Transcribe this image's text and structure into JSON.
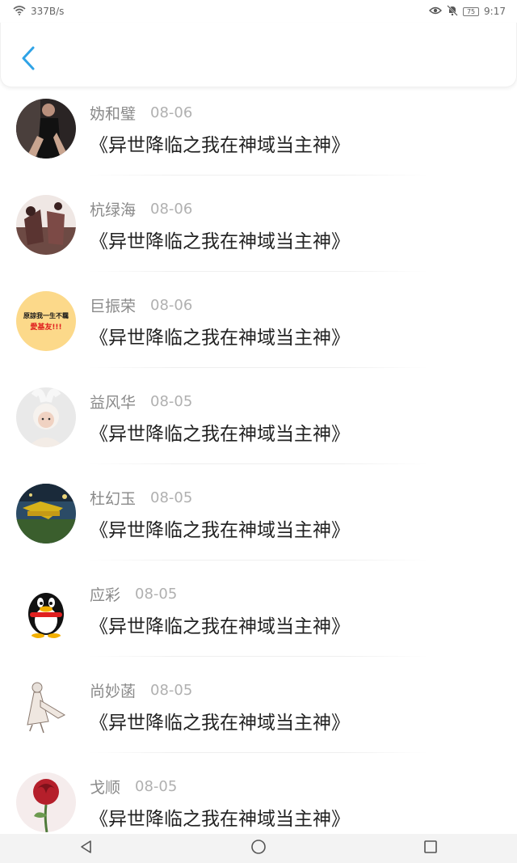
{
  "status_bar": {
    "network_speed": "337B/s",
    "battery": "75",
    "time": "9:17"
  },
  "header": {
    "back_icon": "chevron-left-icon",
    "accent": "#2fa3e6"
  },
  "items": [
    {
      "name": "妫和璧",
      "date": "08-06",
      "title": "《异世降临之我在神域当主神》"
    },
    {
      "name": "杭绿海",
      "date": "08-06",
      "title": "《异世降临之我在神域当主神》"
    },
    {
      "name": "巨振荣",
      "date": "08-06",
      "title": "《异世降临之我在神域当主神》",
      "avatar_text_1": "原諒我一生不羈",
      "avatar_text_2": "愛基友!!!"
    },
    {
      "name": "益风华",
      "date": "08-05",
      "title": "《异世降临之我在神域当主神》"
    },
    {
      "name": "杜幻玉",
      "date": "08-05",
      "title": "《异世降临之我在神域当主神》"
    },
    {
      "name": "应彩",
      "date": "08-05",
      "title": "《异世降临之我在神域当主神》"
    },
    {
      "name": "尚妙菡",
      "date": "08-05",
      "title": "《异世降临之我在神域当主神》"
    },
    {
      "name": "戈顺",
      "date": "08-05",
      "title": "《异世降临之我在神域当主神》"
    }
  ],
  "nav": {
    "back_icon": "triangle-back-icon",
    "home_icon": "circle-home-icon",
    "recents_icon": "square-recents-icon"
  }
}
